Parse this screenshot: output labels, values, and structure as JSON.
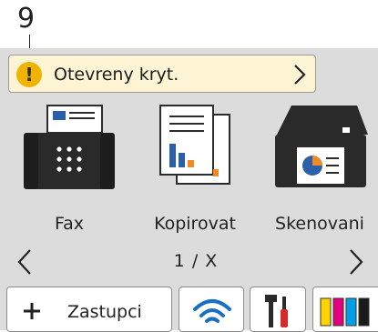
{
  "callout": {
    "number": "9"
  },
  "status_bar": {
    "message": "Otevreny kryt.",
    "icon": "warning-icon"
  },
  "apps": [
    {
      "label": "Fax",
      "icon": "fax-icon"
    },
    {
      "label": "Kopirovat",
      "icon": "copy-icon"
    },
    {
      "label": "Skenovani",
      "icon": "scanner-icon"
    }
  ],
  "pager": {
    "indicator": "1 / X"
  },
  "bottom_bar": {
    "shortcuts_label": "Zastupci",
    "buttons": [
      "plus-icon",
      "wifi-icon",
      "tools-icon",
      "toner-icon"
    ]
  },
  "colors": {
    "screen_bg": "#dcdcdc",
    "status_bg": "#fdf4d4",
    "warning": "#f0b400",
    "fax_blue": "#2b5fa8",
    "chart_orange": "#f08a24",
    "wifi_blue": "#1a6fc4",
    "toner": [
      "#ffd400",
      "#e4007c",
      "#00a0e9",
      "#1a1a1a"
    ]
  }
}
